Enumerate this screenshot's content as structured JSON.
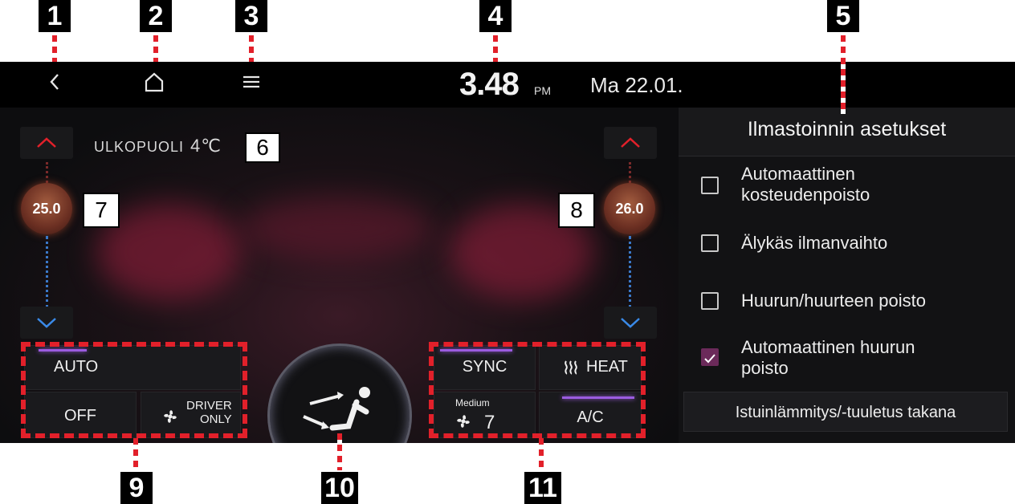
{
  "topbar": {
    "back_icon": "back-icon",
    "home_icon": "home-icon",
    "menu_icon": "menu-icon",
    "time": "3.48",
    "ampm": "PM",
    "date": "Ma 22.01."
  },
  "climate": {
    "outside_label": "ULKOPUOLI",
    "outside_temp": "4℃",
    "left_temp": "25.0",
    "right_temp": "26.0",
    "buttons": {
      "auto": "AUTO",
      "off": "OFF",
      "driver_only": "DRIVER\nONLY",
      "sync": "SYNC",
      "heat": "HEAT",
      "fan_mode": "Medium",
      "fan_level": "7",
      "ac": "A/C"
    }
  },
  "settings_panel": {
    "title": "Ilmastoinnin asetukset",
    "options": [
      {
        "label": "Automaattinen\nkosteudenpoisto",
        "checked": false
      },
      {
        "label": "Älykäs ilmanvaihto",
        "checked": false
      },
      {
        "label": "Huurun/huurteen poisto",
        "checked": false
      },
      {
        "label": "Automaattinen huurun\npoisto",
        "checked": true
      }
    ],
    "seat_button": "Istuinlämmitys/-tuuletus takana"
  },
  "callouts": [
    "1",
    "2",
    "3",
    "4",
    "5",
    "6",
    "7",
    "8",
    "9",
    "10",
    "11"
  ],
  "colors": {
    "accent_red": "#e2202a",
    "accent_purple": "#9b5ce0",
    "checked": "#6b2a5a"
  }
}
